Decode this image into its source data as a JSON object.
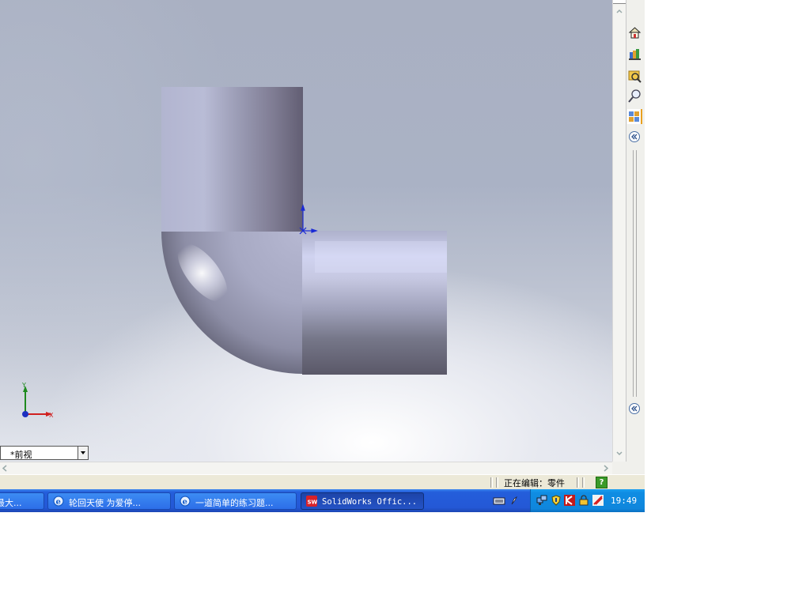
{
  "viewport": {
    "view_name": "*前视",
    "axis_x_label": "X",
    "axis_y_label": "Y"
  },
  "task_pane": {
    "icons": [
      "home-icon",
      "library-icon",
      "file-explorer-icon",
      "search-icon",
      "view-palette-icon",
      "collapse-icon",
      "collapse-icon"
    ]
  },
  "statusbar": {
    "editing_text": "正在编辑：零件",
    "help_label": "?"
  },
  "taskbar": {
    "buttons": [
      {
        "label": "最大...",
        "icon": "none"
      },
      {
        "label": "轮回天使 为爱停...",
        "icon": "ie-icon"
      },
      {
        "label": "一道简单的练习题...",
        "icon": "ie-icon"
      },
      {
        "label": "SolidWorks Offic...",
        "icon": "solidworks-icon",
        "active": true
      }
    ],
    "clock": "19:49"
  },
  "colors": {
    "taskbar_blue": "#245edb",
    "tray_blue": "#0f8de3",
    "part_steel": "#8c90a8"
  }
}
